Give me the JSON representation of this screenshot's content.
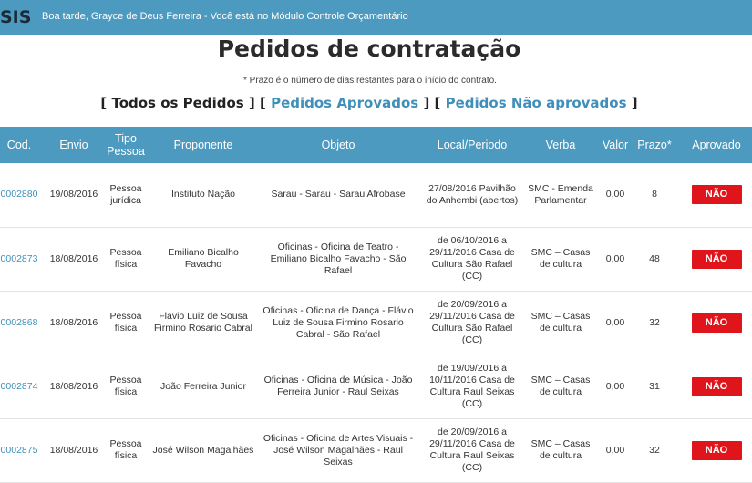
{
  "header": {
    "logo": "SIS",
    "greeting": "Boa tarde, Grayce de Deus Ferreira - Você está no Módulo Controle Orçamentário"
  },
  "page": {
    "title": "Pedidos de contratação",
    "note": "* Prazo é o número de dias restantes para o início do contrato."
  },
  "filters": {
    "all": "Todos os Pedidos",
    "approved": "Pedidos Aprovados",
    "not_approved": "Pedidos Não aprovados"
  },
  "table": {
    "headers": [
      "Cod.",
      "Envio",
      "Tipo Pessoa",
      "Proponente",
      "Objeto",
      "Local/Periodo",
      "Verba",
      "Valor",
      "Prazo*",
      "Aprovado"
    ],
    "rows": [
      {
        "cod": "0002880",
        "envio": "19/08/2016",
        "tipo": "Pessoa jurídica",
        "proponente": "Instituto Nação",
        "objeto": "Sarau - Sarau - Sarau Afrobase",
        "local": "27/08/2016 Pavilhão do Anhembi (abertos)",
        "verba": "SMC - Emenda Parlamentar",
        "valor": "0,00",
        "prazo": "8",
        "aprovado": "NÃO"
      },
      {
        "cod": "0002873",
        "envio": "18/08/2016",
        "tipo": "Pessoa física",
        "proponente": "Emiliano Bicalho Favacho",
        "objeto": "Oficinas - Oficina de Teatro - Emiliano Bicalho Favacho - São Rafael",
        "local": "de 06/10/2016 a 29/11/2016 Casa de Cultura São Rafael (CC)",
        "verba": "SMC – Casas de cultura",
        "valor": "0,00",
        "prazo": "48",
        "aprovado": "NÃO"
      },
      {
        "cod": "0002868",
        "envio": "18/08/2016",
        "tipo": "Pessoa física",
        "proponente": "Flávio Luiz de Sousa Firmino Rosario Cabral",
        "objeto": "Oficinas - Oficina de Dança - Flávio Luiz de Sousa Firmino Rosario Cabral - São Rafael",
        "local": "de 20/09/2016 a 29/11/2016 Casa de Cultura São Rafael (CC)",
        "verba": "SMC – Casas de cultura",
        "valor": "0,00",
        "prazo": "32",
        "aprovado": "NÃO"
      },
      {
        "cod": "0002874",
        "envio": "18/08/2016",
        "tipo": "Pessoa física",
        "proponente": "João Ferreira Junior",
        "objeto": "Oficinas - Oficina de Música - João Ferreira Junior - Raul Seixas",
        "local": "de 19/09/2016 a 10/11/2016 Casa de Cultura Raul Seixas (CC)",
        "verba": "SMC – Casas de cultura",
        "valor": "0,00",
        "prazo": "31",
        "aprovado": "NÃO"
      },
      {
        "cod": "0002875",
        "envio": "18/08/2016",
        "tipo": "Pessoa física",
        "proponente": "José Wilson Magalhães",
        "objeto": "Oficinas - Oficina de Artes Visuais - José Wilson Magalhães - Raul Seixas",
        "local": "de 20/09/2016 a 29/11/2016 Casa de Cultura Raul Seixas (CC)",
        "verba": "SMC – Casas de cultura",
        "valor": "0,00",
        "prazo": "32",
        "aprovado": "NÃO"
      }
    ]
  },
  "colors": {
    "accent": "#4d9ac0",
    "link": "#3f8fba",
    "reject": "#e0141b"
  }
}
